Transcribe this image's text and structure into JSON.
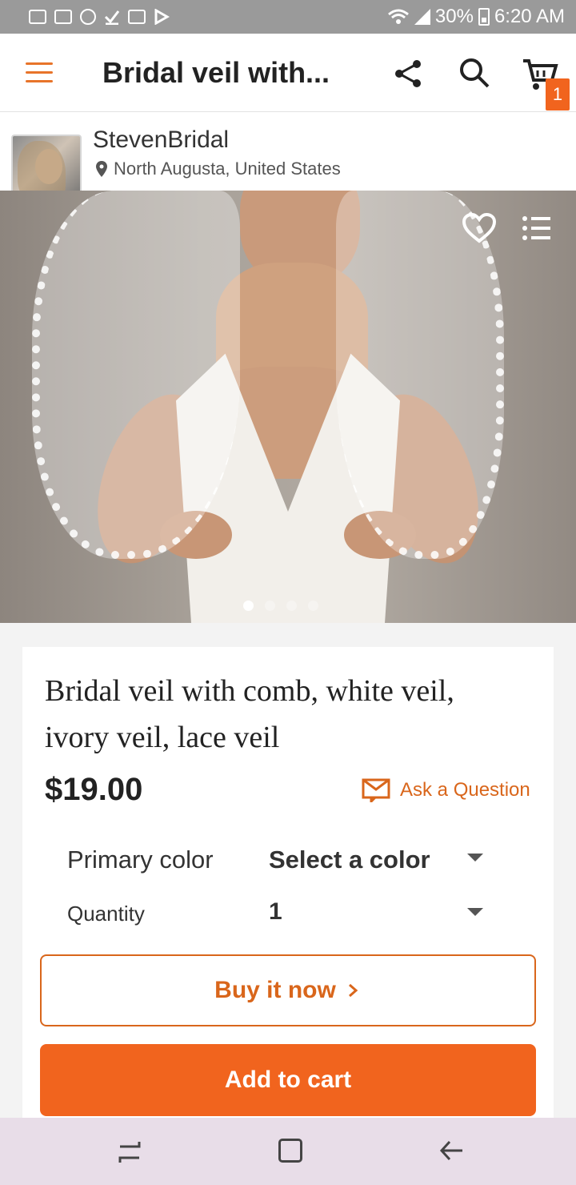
{
  "status_bar": {
    "battery": "30%",
    "time": "6:20 AM"
  },
  "app_bar": {
    "title": "Bridal veil with...",
    "cart_count": "1"
  },
  "shop": {
    "name": "StevenBridal",
    "location": "North Augusta, United States"
  },
  "gallery": {
    "image_count": 4,
    "active_index": 1
  },
  "product": {
    "title": "Bridal veil with comb, white veil, ivory veil, lace veil",
    "price": "$19.00",
    "ask_label": "Ask a Question"
  },
  "options": {
    "color_label": "Primary color",
    "color_value": "Select a color",
    "quantity_label": "Quantity",
    "quantity_value": "1"
  },
  "actions": {
    "buy_now": "Buy it now",
    "add_to_cart": "Add to cart"
  },
  "colors": {
    "accent": "#f1641e",
    "accent_text": "#d9661b",
    "status_bar": "#9a9a9a",
    "nav_bar": "#e8dde8"
  }
}
